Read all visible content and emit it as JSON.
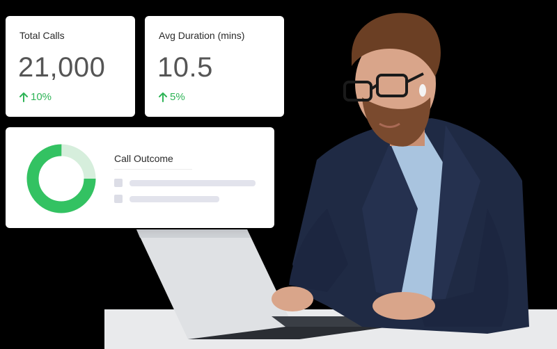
{
  "stats": [
    {
      "label": "Total Calls",
      "value": "21,000",
      "delta": "10%",
      "direction": "up"
    },
    {
      "label": "Avg Duration (mins)",
      "value": "10.5",
      "delta": "5%",
      "direction": "up"
    }
  ],
  "call_outcome": {
    "title": "Call Outcome",
    "donut_share": 0.75,
    "colors": {
      "primary": "#33c262",
      "secondary": "#d6eedc"
    },
    "legend_rows": 2
  },
  "colors": {
    "positive": "#2fb457",
    "background": "#000000"
  }
}
